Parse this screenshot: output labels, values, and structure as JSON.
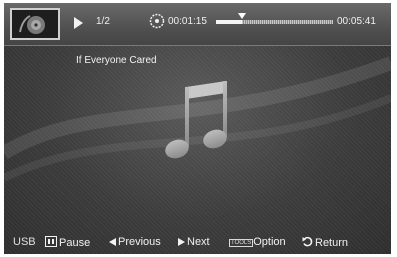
{
  "top_bar": {
    "track_counter": "1/2",
    "elapsed_time": "00:01:15",
    "total_time": "00:05:41",
    "progress_fraction": 0.22
  },
  "song": {
    "title": "If Everyone Cared"
  },
  "bottom_bar": {
    "source": "USB",
    "pause_label": "Pause",
    "previous_label": "Previous",
    "next_label": "Next",
    "tools_key": "TOOLS",
    "option_label": "Option",
    "return_label": "Return"
  },
  "icons": {
    "play": "play-icon",
    "clock": "clock-icon",
    "music": "music-note-icon",
    "pause": "pause-icon",
    "previous": "previous-icon",
    "next": "next-icon",
    "return": "return-icon"
  },
  "colors": {
    "background": "#3c3c3c",
    "text": "#f2f2f2"
  }
}
